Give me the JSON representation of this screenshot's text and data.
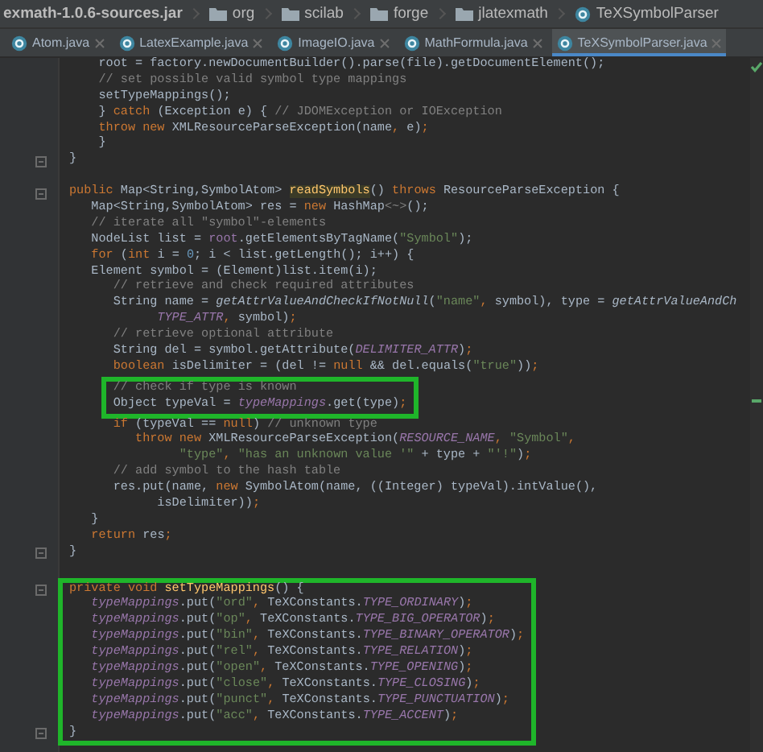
{
  "breadcrumb": [
    {
      "kind": "jar",
      "label": "exmath-1.0.6-sources.jar"
    },
    {
      "kind": "folder",
      "label": "org"
    },
    {
      "kind": "folder",
      "label": "scilab"
    },
    {
      "kind": "folder",
      "label": "forge"
    },
    {
      "kind": "folder",
      "label": "jlatexmath"
    },
    {
      "kind": "class",
      "label": "TeXSymbolParser"
    }
  ],
  "tabs": [
    {
      "label": "Atom.java",
      "selected": false
    },
    {
      "label": "LatexExample.java",
      "selected": false
    },
    {
      "label": "ImageIO.java",
      "selected": false
    },
    {
      "label": "MathFormula.java",
      "selected": false
    },
    {
      "label": "TeXSymbolParser.java",
      "selected": true
    }
  ],
  "sections": [
    {
      "kind": "plain",
      "lines": [
        {
          "kind": "code",
          "fold": false,
          "tokens": [
            {
              "kind": "plain",
              "text": "    root = factory.newDocumentBuilder().parse(file).getDocumentElement();"
            }
          ]
        },
        {
          "kind": "code",
          "fold": false,
          "tokens": [
            {
              "kind": "comment",
              "text": "    // set possible valid symbol type mappings"
            }
          ]
        },
        {
          "kind": "code",
          "fold": false,
          "tokens": [
            {
              "kind": "plain",
              "text": "    setTypeMappings();"
            }
          ]
        },
        {
          "kind": "code",
          "fold": false,
          "tokens": [
            {
              "kind": "plain",
              "text": "    } "
            },
            {
              "kind": "keyword",
              "text": "catch"
            },
            {
              "kind": "plain",
              "text": " (Exception e) { "
            },
            {
              "kind": "comment",
              "text": "// JDOMException or IOException"
            }
          ]
        },
        {
          "kind": "code",
          "fold": false,
          "tokens": [
            {
              "kind": "keyword",
              "text": "    throw new "
            },
            {
              "kind": "plain",
              "text": "XMLResourceParseException(name"
            },
            {
              "kind": "keyword",
              "text": ","
            },
            {
              "kind": "plain",
              "text": " e)"
            },
            {
              "kind": "keyword",
              "text": ";"
            }
          ]
        },
        {
          "kind": "code",
          "fold": false,
          "tokens": [
            {
              "kind": "plain",
              "text": "    }"
            }
          ]
        },
        {
          "kind": "code",
          "fold": true,
          "tokens": [
            {
              "kind": "plain",
              "text": "}"
            }
          ]
        },
        {
          "kind": "blank"
        },
        {
          "kind": "code",
          "fold": true,
          "tokens": [
            {
              "kind": "keyword",
              "text": "public "
            },
            {
              "kind": "plain",
              "text": "Map<String,SymbolAtom> "
            },
            {
              "kind": "highlight",
              "text": "readSymbols"
            },
            {
              "kind": "plain",
              "text": "() "
            },
            {
              "kind": "keyword",
              "text": "throws "
            },
            {
              "kind": "plain",
              "text": "ResourceParseException {"
            }
          ]
        },
        {
          "kind": "code",
          "fold": false,
          "tokens": [
            {
              "kind": "plain",
              "text": "   Map<String,SymbolAtom> res = "
            },
            {
              "kind": "keyword",
              "text": "new "
            },
            {
              "kind": "plain",
              "text": "HashMap"
            },
            {
              "kind": "comment",
              "text": "<~>"
            },
            {
              "kind": "plain",
              "text": "();"
            }
          ]
        },
        {
          "kind": "code",
          "fold": false,
          "tokens": [
            {
              "kind": "comment",
              "text": "   // iterate all \"symbol\"-elements"
            }
          ]
        },
        {
          "kind": "code",
          "fold": false,
          "tokens": [
            {
              "kind": "plain",
              "text": "   NodeList list = "
            },
            {
              "kind": "field",
              "text": "root"
            },
            {
              "kind": "plain",
              "text": ".getElementsByTagName("
            },
            {
              "kind": "string",
              "text": "\"Symbol\""
            },
            {
              "kind": "plain",
              "text": ");"
            }
          ]
        },
        {
          "kind": "code",
          "fold": false,
          "tokens": [
            {
              "kind": "keyword",
              "text": "   for "
            },
            {
              "kind": "plain",
              "text": "("
            },
            {
              "kind": "keyword",
              "text": "int "
            },
            {
              "kind": "plain",
              "text": "i = "
            },
            {
              "kind": "number",
              "text": "0"
            },
            {
              "kind": "plain",
              "text": "; i < list.getLength(); i++) {"
            }
          ]
        },
        {
          "kind": "code",
          "fold": false,
          "tokens": [
            {
              "kind": "plain",
              "text": "   Element symbol = (Element)list.item(i);"
            }
          ]
        },
        {
          "kind": "code",
          "fold": false,
          "tokens": [
            {
              "kind": "comment",
              "text": "      // retrieve and check required attributes"
            }
          ]
        },
        {
          "kind": "code",
          "fold": false,
          "tokens": [
            {
              "kind": "plain",
              "text": "      String name = "
            },
            {
              "kind": "call",
              "text": "getAttrValueAndCheckIfNotNull"
            },
            {
              "kind": "plain",
              "text": "("
            },
            {
              "kind": "string",
              "text": "\"name\""
            },
            {
              "kind": "keyword",
              "text": ", "
            },
            {
              "kind": "plain",
              "text": "symbol), type = "
            },
            {
              "kind": "call",
              "text": "getAttrValueAndCh"
            }
          ]
        },
        {
          "kind": "code",
          "fold": false,
          "tokens": [
            {
              "kind": "constant",
              "text": "            TYPE_ATTR"
            },
            {
              "kind": "keyword",
              "text": ", "
            },
            {
              "kind": "plain",
              "text": "symbol)"
            },
            {
              "kind": "keyword",
              "text": ";"
            }
          ]
        },
        {
          "kind": "code",
          "fold": false,
          "tokens": [
            {
              "kind": "comment",
              "text": "      // retrieve optional attribute"
            }
          ]
        },
        {
          "kind": "code",
          "fold": false,
          "tokens": [
            {
              "kind": "plain",
              "text": "      String del = symbol.getAttribute("
            },
            {
              "kind": "constant",
              "text": "DELIMITER_ATTR"
            },
            {
              "kind": "plain",
              "text": ")"
            },
            {
              "kind": "keyword",
              "text": ";"
            }
          ]
        },
        {
          "kind": "code",
          "fold": false,
          "tokens": [
            {
              "kind": "keyword",
              "text": "      boolean "
            },
            {
              "kind": "plain",
              "text": "isDelimiter = (del != "
            },
            {
              "kind": "keyword",
              "text": "null "
            },
            {
              "kind": "plain",
              "text": "&& del.equals("
            },
            {
              "kind": "string",
              "text": "\"true\""
            },
            {
              "kind": "plain",
              "text": "))"
            },
            {
              "kind": "keyword",
              "text": ";"
            }
          ]
        }
      ]
    },
    {
      "kind": "highlighted",
      "lines": [
        {
          "kind": "code",
          "fold": false,
          "tokens": [
            {
              "kind": "comment",
              "text": "      // check if type is known"
            }
          ]
        },
        {
          "kind": "code",
          "fold": false,
          "tokens": [
            {
              "kind": "plain",
              "text": "      Object typeVal = "
            },
            {
              "kind": "constant",
              "text": "typeMappings"
            },
            {
              "kind": "plain",
              "text": ".get(type)"
            },
            {
              "kind": "keyword",
              "text": ";"
            }
          ]
        }
      ]
    },
    {
      "kind": "plain",
      "lines": [
        {
          "kind": "code",
          "fold": false,
          "tokens": [
            {
              "kind": "keyword",
              "text": "      if "
            },
            {
              "kind": "plain",
              "text": "(typeVal == "
            },
            {
              "kind": "keyword",
              "text": "null"
            },
            {
              "kind": "plain",
              "text": ") "
            },
            {
              "kind": "comment",
              "text": "// unknown type"
            }
          ]
        },
        {
          "kind": "code",
          "fold": false,
          "tokens": [
            {
              "kind": "keyword",
              "text": "         throw new "
            },
            {
              "kind": "plain",
              "text": "XMLResourceParseException("
            },
            {
              "kind": "constant",
              "text": "RESOURCE_NAME"
            },
            {
              "kind": "keyword",
              "text": ", "
            },
            {
              "kind": "string",
              "text": "\"Symbol\""
            },
            {
              "kind": "keyword",
              "text": ","
            }
          ]
        },
        {
          "kind": "code",
          "fold": false,
          "tokens": [
            {
              "kind": "string",
              "text": "               \"type\""
            },
            {
              "kind": "keyword",
              "text": ", "
            },
            {
              "kind": "string",
              "text": "\"has an unknown value '\""
            },
            {
              "kind": "plain",
              "text": " + type + "
            },
            {
              "kind": "string",
              "text": "\"'!\""
            },
            {
              "kind": "plain",
              "text": ")"
            },
            {
              "kind": "keyword",
              "text": ";"
            }
          ]
        },
        {
          "kind": "code",
          "fold": false,
          "tokens": [
            {
              "kind": "comment",
              "text": "      // add symbol to the hash table"
            }
          ]
        },
        {
          "kind": "code",
          "fold": false,
          "tokens": [
            {
              "kind": "plain",
              "text": "      res.put(name, "
            },
            {
              "kind": "keyword",
              "text": "new "
            },
            {
              "kind": "plain",
              "text": "SymbolAtom(name, ((Integer) typeVal).intValue(),"
            }
          ]
        },
        {
          "kind": "code",
          "fold": false,
          "tokens": [
            {
              "kind": "plain",
              "text": "            isDelimiter))"
            },
            {
              "kind": "keyword",
              "text": ";"
            }
          ]
        },
        {
          "kind": "code",
          "fold": false,
          "tokens": [
            {
              "kind": "plain",
              "text": "   }"
            }
          ]
        },
        {
          "kind": "code",
          "fold": false,
          "tokens": [
            {
              "kind": "keyword",
              "text": "   return "
            },
            {
              "kind": "plain",
              "text": "res"
            },
            {
              "kind": "keyword",
              "text": ";"
            }
          ]
        },
        {
          "kind": "code",
          "fold": true,
          "tokens": [
            {
              "kind": "plain",
              "text": "}"
            }
          ]
        },
        {
          "kind": "blank"
        }
      ]
    },
    {
      "kind": "highlighted",
      "lines": [
        {
          "kind": "code",
          "fold": true,
          "tokens": [
            {
              "kind": "keyword",
              "text": "private void "
            },
            {
              "kind": "method",
              "text": "setTypeMappings"
            },
            {
              "kind": "plain",
              "text": "() {"
            }
          ]
        },
        {
          "kind": "code",
          "fold": false,
          "tokens": [
            {
              "kind": "constant",
              "text": "   typeMappings"
            },
            {
              "kind": "plain",
              "text": ".put("
            },
            {
              "kind": "string",
              "text": "\"ord\""
            },
            {
              "kind": "keyword",
              "text": ", "
            },
            {
              "kind": "plain",
              "text": "TeXConstants."
            },
            {
              "kind": "constant",
              "text": "TYPE_ORDINARY"
            },
            {
              "kind": "plain",
              "text": ")"
            },
            {
              "kind": "keyword",
              "text": ";"
            }
          ]
        },
        {
          "kind": "code",
          "fold": false,
          "tokens": [
            {
              "kind": "constant",
              "text": "   typeMappings"
            },
            {
              "kind": "plain",
              "text": ".put("
            },
            {
              "kind": "string",
              "text": "\"op\""
            },
            {
              "kind": "keyword",
              "text": ", "
            },
            {
              "kind": "plain",
              "text": "TeXConstants."
            },
            {
              "kind": "constant",
              "text": "TYPE_BIG_OPERATOR"
            },
            {
              "kind": "plain",
              "text": ")"
            },
            {
              "kind": "keyword",
              "text": ";"
            }
          ]
        },
        {
          "kind": "code",
          "fold": false,
          "tokens": [
            {
              "kind": "constant",
              "text": "   typeMappings"
            },
            {
              "kind": "plain",
              "text": ".put("
            },
            {
              "kind": "string",
              "text": "\"bin\""
            },
            {
              "kind": "keyword",
              "text": ", "
            },
            {
              "kind": "plain",
              "text": "TeXConstants."
            },
            {
              "kind": "constant",
              "text": "TYPE_BINARY_OPERATOR"
            },
            {
              "kind": "plain",
              "text": ")"
            },
            {
              "kind": "keyword",
              "text": ";"
            }
          ]
        },
        {
          "kind": "code",
          "fold": false,
          "tokens": [
            {
              "kind": "constant",
              "text": "   typeMappings"
            },
            {
              "kind": "plain",
              "text": ".put("
            },
            {
              "kind": "string",
              "text": "\"rel\""
            },
            {
              "kind": "keyword",
              "text": ", "
            },
            {
              "kind": "plain",
              "text": "TeXConstants."
            },
            {
              "kind": "constant",
              "text": "TYPE_RELATION"
            },
            {
              "kind": "plain",
              "text": ")"
            },
            {
              "kind": "keyword",
              "text": ";"
            }
          ]
        },
        {
          "kind": "code",
          "fold": false,
          "tokens": [
            {
              "kind": "constant",
              "text": "   typeMappings"
            },
            {
              "kind": "plain",
              "text": ".put("
            },
            {
              "kind": "string",
              "text": "\"open\""
            },
            {
              "kind": "keyword",
              "text": ", "
            },
            {
              "kind": "plain",
              "text": "TeXConstants."
            },
            {
              "kind": "constant",
              "text": "TYPE_OPENING"
            },
            {
              "kind": "plain",
              "text": ")"
            },
            {
              "kind": "keyword",
              "text": ";"
            }
          ]
        },
        {
          "kind": "code",
          "fold": false,
          "tokens": [
            {
              "kind": "constant",
              "text": "   typeMappings"
            },
            {
              "kind": "plain",
              "text": ".put("
            },
            {
              "kind": "string",
              "text": "\"close\""
            },
            {
              "kind": "keyword",
              "text": ", "
            },
            {
              "kind": "plain",
              "text": "TeXConstants."
            },
            {
              "kind": "constant",
              "text": "TYPE_CLOSING"
            },
            {
              "kind": "plain",
              "text": ")"
            },
            {
              "kind": "keyword",
              "text": ";"
            }
          ]
        },
        {
          "kind": "code",
          "fold": false,
          "tokens": [
            {
              "kind": "constant",
              "text": "   typeMappings"
            },
            {
              "kind": "plain",
              "text": ".put("
            },
            {
              "kind": "string",
              "text": "\"punct\""
            },
            {
              "kind": "keyword",
              "text": ", "
            },
            {
              "kind": "plain",
              "text": "TeXConstants."
            },
            {
              "kind": "constant",
              "text": "TYPE_PUNCTUATION"
            },
            {
              "kind": "plain",
              "text": ")"
            },
            {
              "kind": "keyword",
              "text": ";"
            }
          ]
        },
        {
          "kind": "code",
          "fold": false,
          "tokens": [
            {
              "kind": "constant",
              "text": "   typeMappings"
            },
            {
              "kind": "plain",
              "text": ".put("
            },
            {
              "kind": "string",
              "text": "\"acc\""
            },
            {
              "kind": "keyword",
              "text": ", "
            },
            {
              "kind": "plain",
              "text": "TeXConstants."
            },
            {
              "kind": "constant",
              "text": "TYPE_ACCENT"
            },
            {
              "kind": "plain",
              "text": ")"
            },
            {
              "kind": "keyword",
              "text": ";"
            }
          ]
        },
        {
          "kind": "code",
          "fold": true,
          "tokens": [
            {
              "kind": "plain",
              "text": "}"
            }
          ]
        }
      ]
    }
  ]
}
